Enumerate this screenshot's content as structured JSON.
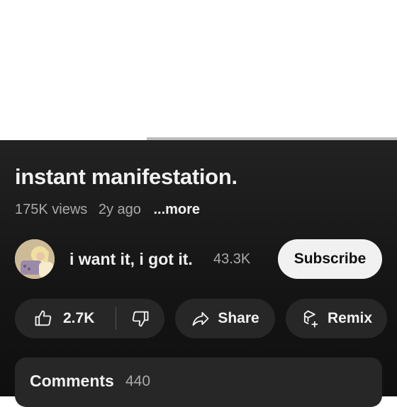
{
  "video": {
    "progress_fraction": 0.37
  },
  "title": "instant manifestation.",
  "meta": {
    "views": "175K views",
    "age": "2y ago",
    "more": "...more"
  },
  "channel": {
    "name": "i want it, i got it.",
    "subscribers": "43.3K",
    "subscribe_label": "Subscribe"
  },
  "actions": {
    "likes": "2.7K",
    "share_label": "Share",
    "remix_label": "Remix"
  },
  "comments": {
    "label": "Comments",
    "count": "440"
  },
  "icons": {
    "like": "thumbs-up-icon",
    "dislike": "thumbs-down-icon",
    "share": "share-arrow-icon",
    "remix": "remix-icon"
  },
  "colors": {
    "panel_bg": "#141414",
    "pill_bg": "#272727",
    "subscribe_bg": "#f1f1f1",
    "secondary_text": "#aaaaaa"
  }
}
